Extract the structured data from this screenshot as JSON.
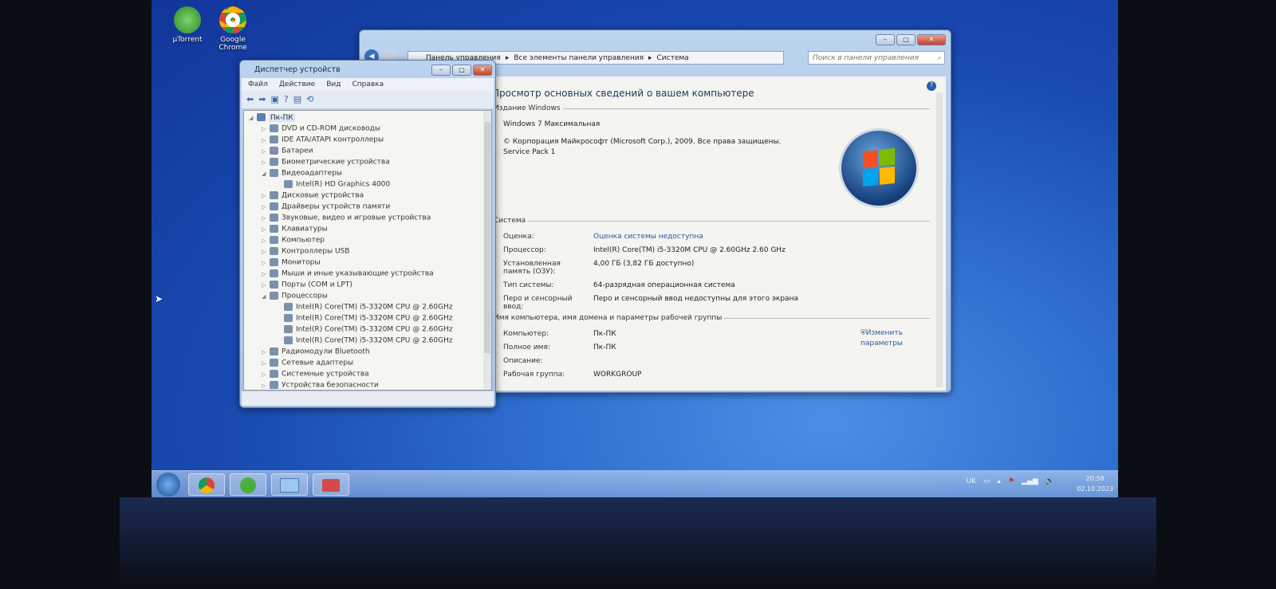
{
  "desktop": {
    "icons": [
      {
        "label": "µTorrent",
        "icon": "utorrent-icon"
      },
      {
        "label": "Google Chrome",
        "icon": "chrome-icon"
      }
    ]
  },
  "device_manager": {
    "title": "Диспетчер устройств",
    "menu": [
      "Файл",
      "Действие",
      "Вид",
      "Справка"
    ],
    "root": "Пк-ПК",
    "items": [
      {
        "label": "DVD и CD-ROM дисководы",
        "level": 1,
        "expanded": false
      },
      {
        "label": "IDE ATA/ATAPI контроллеры",
        "level": 1,
        "expanded": false
      },
      {
        "label": "Батареи",
        "level": 1,
        "expanded": false
      },
      {
        "label": "Биометрические устройства",
        "level": 1,
        "expanded": false
      },
      {
        "label": "Видеоадаптеры",
        "level": 1,
        "expanded": true
      },
      {
        "label": "Intel(R) HD Graphics 4000",
        "level": 2
      },
      {
        "label": "Дисковые устройства",
        "level": 1,
        "expanded": false
      },
      {
        "label": "Драйверы устройств памяти",
        "level": 1,
        "expanded": false
      },
      {
        "label": "Звуковые, видео и игровые устройства",
        "level": 1,
        "expanded": false
      },
      {
        "label": "Клавиатуры",
        "level": 1,
        "expanded": false
      },
      {
        "label": "Компьютер",
        "level": 1,
        "expanded": false
      },
      {
        "label": "Контроллеры USB",
        "level": 1,
        "expanded": false
      },
      {
        "label": "Мониторы",
        "level": 1,
        "expanded": false
      },
      {
        "label": "Мыши и иные указывающие устройства",
        "level": 1,
        "expanded": false
      },
      {
        "label": "Порты (COM и LPT)",
        "level": 1,
        "expanded": false
      },
      {
        "label": "Процессоры",
        "level": 1,
        "expanded": true
      },
      {
        "label": "Intel(R) Core(TM) i5-3320M CPU @ 2.60GHz",
        "level": 2
      },
      {
        "label": "Intel(R) Core(TM) i5-3320M CPU @ 2.60GHz",
        "level": 2
      },
      {
        "label": "Intel(R) Core(TM) i5-3320M CPU @ 2.60GHz",
        "level": 2
      },
      {
        "label": "Intel(R) Core(TM) i5-3320M CPU @ 2.60GHz",
        "level": 2
      },
      {
        "label": "Радиомодули Bluetooth",
        "level": 1,
        "expanded": false
      },
      {
        "label": "Сетевые адаптеры",
        "level": 1,
        "expanded": false
      },
      {
        "label": "Системные устройства",
        "level": 1,
        "expanded": false
      },
      {
        "label": "Устройства безопасности",
        "level": 1,
        "expanded": false
      }
    ]
  },
  "system": {
    "breadcrumb": [
      "Панель управления",
      "Все элементы панели управления",
      "Система"
    ],
    "search_placeholder": "Поиск в панели управления",
    "heading": "Просмотр основных сведений о вашем компьютере",
    "edition_section": "Издание Windows",
    "edition": "Windows 7 Максимальная",
    "copyright": "© Корпорация Майкрософт (Microsoft Corp.), 2009. Все права защищены.",
    "service_pack": "Service Pack 1",
    "system_section": "Система",
    "system_rows": [
      {
        "label": "Оценка:",
        "value": "Оценка системы недоступна",
        "link": true
      },
      {
        "label": "Процессор:",
        "value": "Intel(R) Core(TM) i5-3320M CPU @ 2.60GHz   2.60 GHz"
      },
      {
        "label": "Установленная память (ОЗУ):",
        "value": "4,00 ГБ (3,82 ГБ доступно)"
      },
      {
        "label": "Тип системы:",
        "value": "64-разрядная операционная система"
      },
      {
        "label": "Перо и сенсорный ввод:",
        "value": "Перо и сенсорный ввод недоступны для этого экрана"
      }
    ],
    "name_section": "Имя компьютера, имя домена и параметры рабочей группы",
    "name_rows": [
      {
        "label": "Компьютер:",
        "value": "Пк-ПК"
      },
      {
        "label": "Полное имя:",
        "value": "Пк-ПК"
      },
      {
        "label": "Описание:",
        "value": ""
      },
      {
        "label": "Рабочая группа:",
        "value": "WORKGROUP"
      }
    ],
    "change_settings": "Изменить параметры"
  },
  "taskbar": {
    "lang": "UK",
    "time": "20:58",
    "date": "02.10.2023",
    "pinned": [
      "start-button",
      "chrome",
      "utorrent",
      "control-panel",
      "device-manager"
    ]
  }
}
